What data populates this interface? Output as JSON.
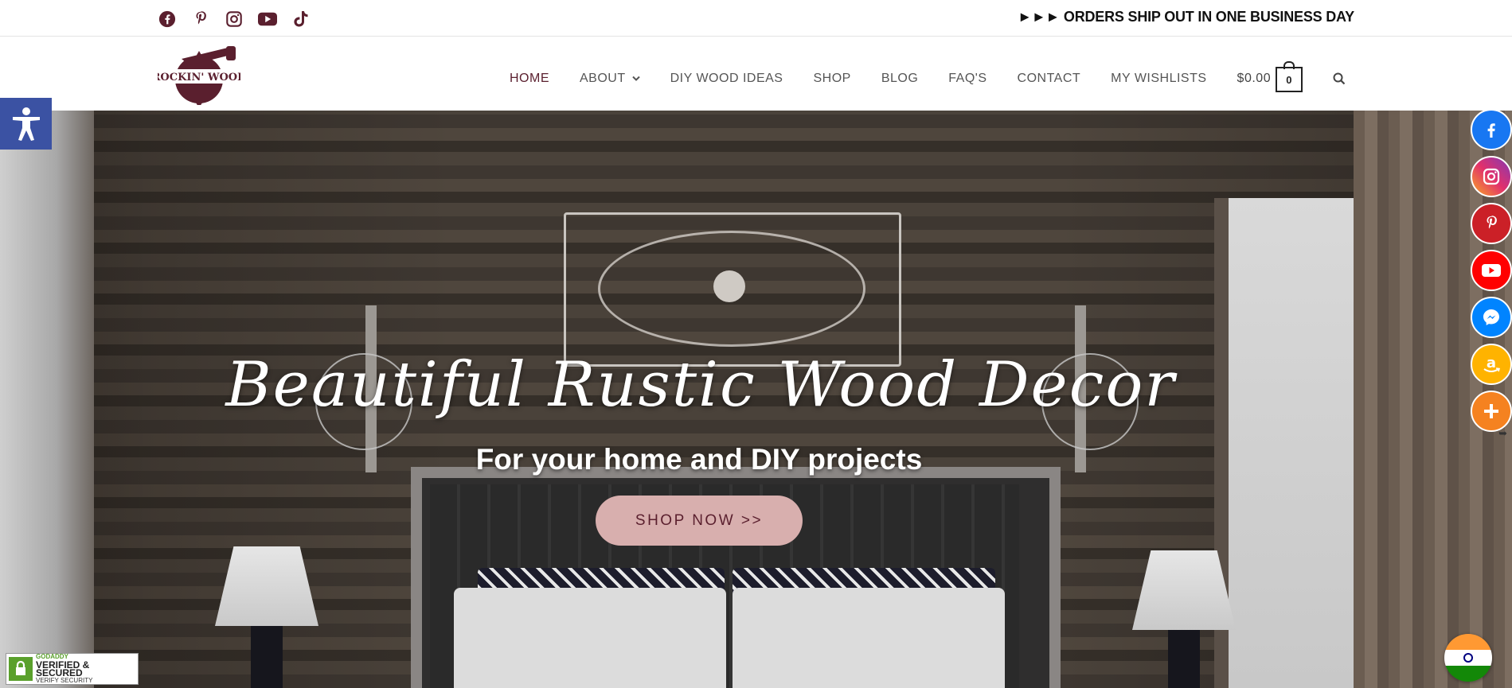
{
  "topbar": {
    "social_icons": [
      "facebook-icon",
      "pinterest-icon",
      "instagram-icon",
      "youtube-icon",
      "tiktok-icon"
    ],
    "shipping_message": "►►► ORDERS SHIP OUT IN ONE BUSINESS DAY"
  },
  "brand": {
    "logo_text": "ROCKIN' WOOD",
    "brand_color": "#5a1f2e"
  },
  "nav": {
    "items": [
      {
        "label": "HOME",
        "active": true
      },
      {
        "label": "ABOUT",
        "dropdown": true
      },
      {
        "label": "DIY WOOD IDEAS"
      },
      {
        "label": "SHOP"
      },
      {
        "label": "BLOG"
      },
      {
        "label": "FAQ'S"
      },
      {
        "label": "CONTACT"
      },
      {
        "label": "MY WISHLISTS"
      }
    ],
    "cart_total": "$0.00",
    "cart_count": "0"
  },
  "hero": {
    "title": "Beautiful Rustic Wood Decor",
    "subtitle": "For your home and DIY projects",
    "cta_label": "SHOP NOW >>"
  },
  "share_bar": {
    "items": [
      {
        "name": "facebook",
        "color": "#1877f2"
      },
      {
        "name": "instagram",
        "color": "#d6249f"
      },
      {
        "name": "pinterest",
        "color": "#cb2027"
      },
      {
        "name": "youtube",
        "color": "#ff0000"
      },
      {
        "name": "messenger",
        "color": "#0084ff"
      },
      {
        "name": "amazon",
        "color": "#ffb300"
      },
      {
        "name": "more",
        "color": "#f58220"
      }
    ]
  },
  "badge": {
    "line1": "GODADDY",
    "line2": "VERIFIED & SECURED",
    "line3": "VERIFY SECURITY"
  }
}
